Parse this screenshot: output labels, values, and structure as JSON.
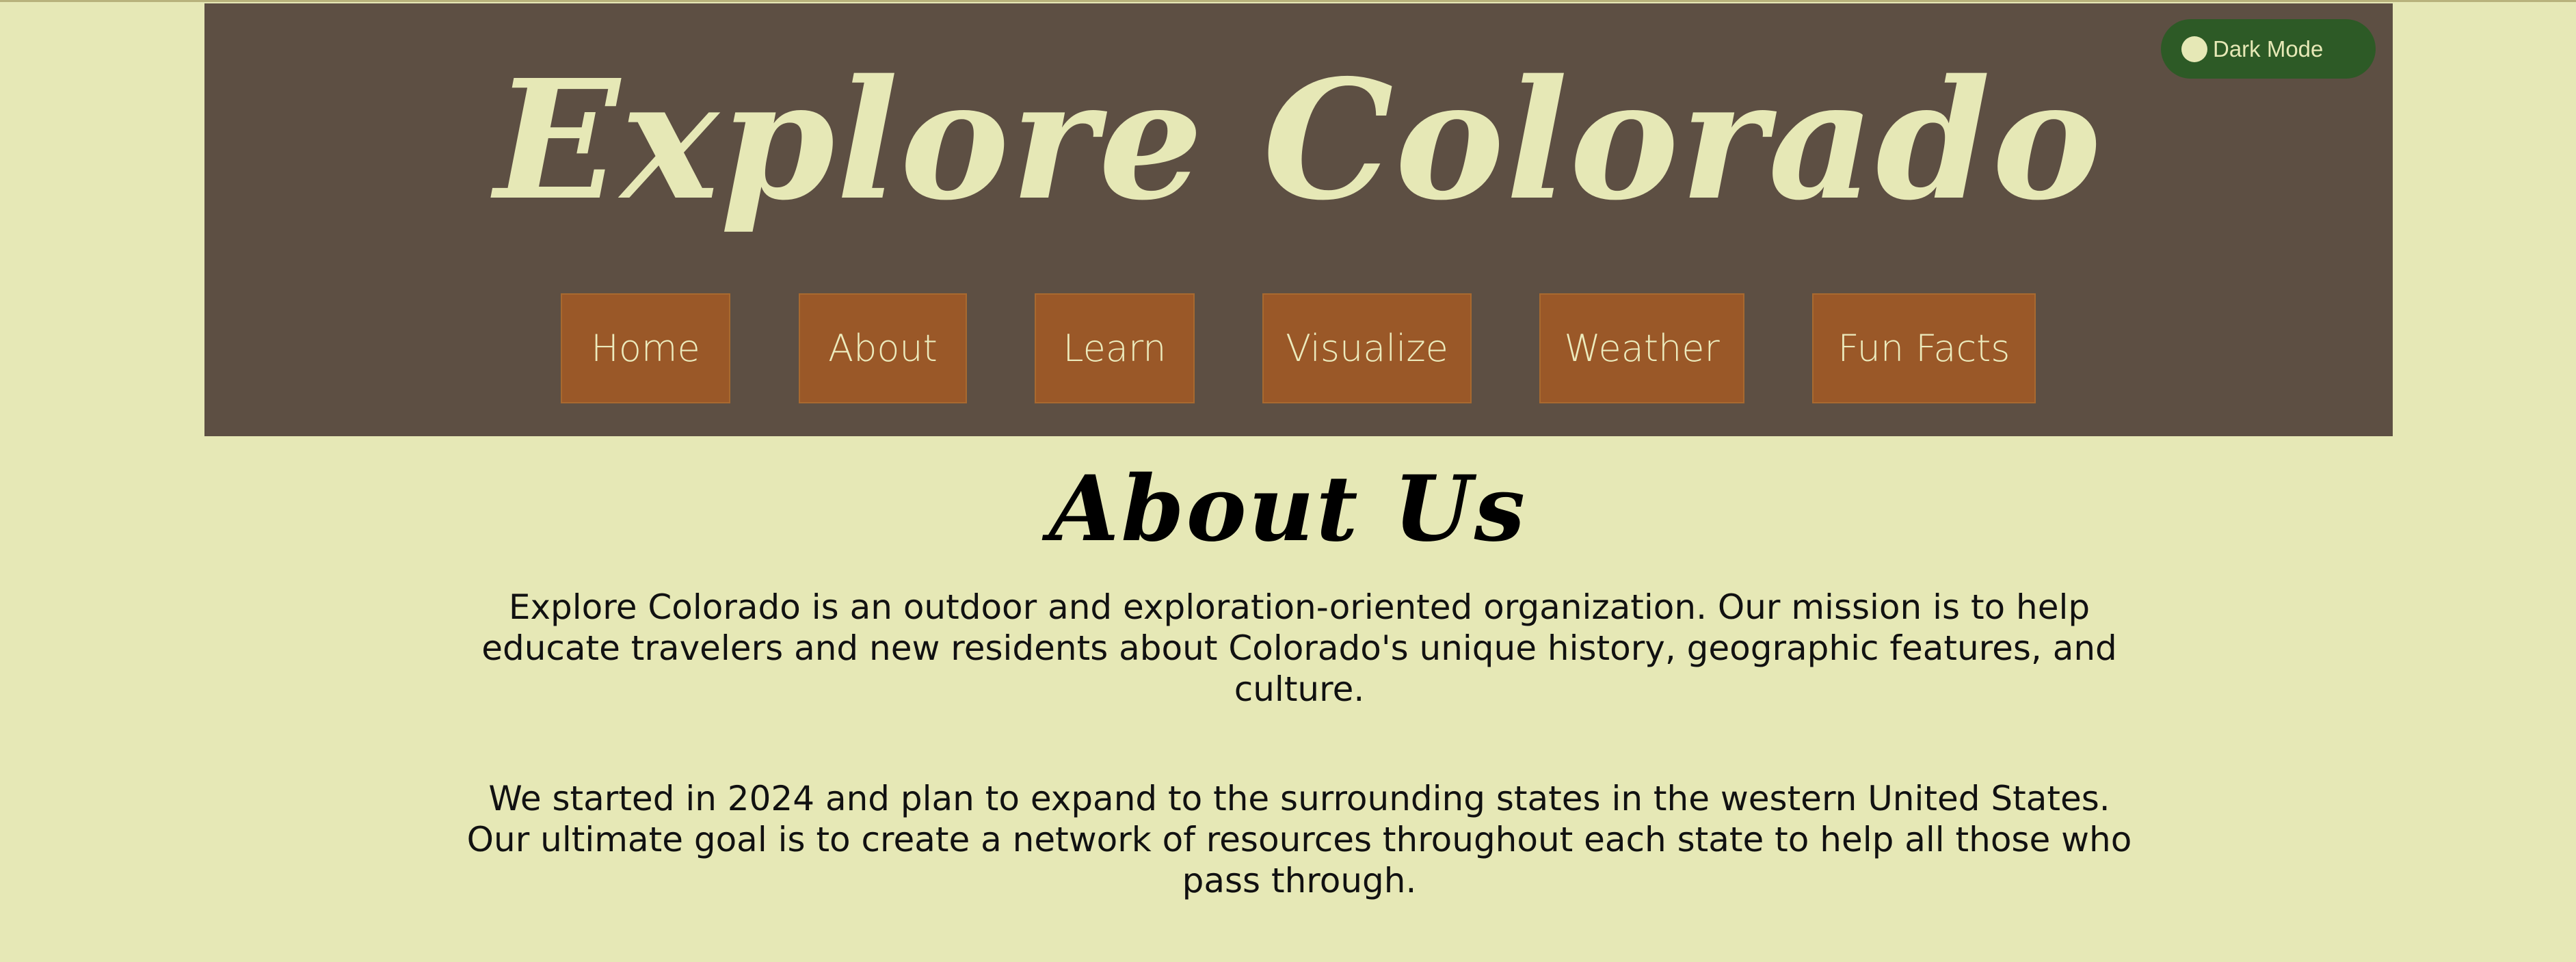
{
  "header": {
    "site_title": "Explore Colorado",
    "dark_mode_label": "Dark Mode"
  },
  "nav": {
    "items": [
      {
        "label": "Home"
      },
      {
        "label": "About"
      },
      {
        "label": "Learn"
      },
      {
        "label": "Visualize"
      },
      {
        "label": "Weather"
      },
      {
        "label": "Fun Facts"
      }
    ]
  },
  "main": {
    "heading": "About Us",
    "paragraphs": [
      "Explore Colorado is an outdoor and exploration-oriented organization. Our mission is to help educate travelers and new residents about Colorado's unique history, geographic features, and culture.",
      "We started in 2024 and plan to expand to the surrounding states in the western United States. Our ultimate goal is to create a network of resources throughout each state to help all those who pass through."
    ]
  },
  "colors": {
    "page_background": "#e6e8b6",
    "header_background": "#5d4f43",
    "nav_button": "#9a5828",
    "toggle_background": "#2d5a26",
    "accent_text": "#e6e8b6"
  }
}
